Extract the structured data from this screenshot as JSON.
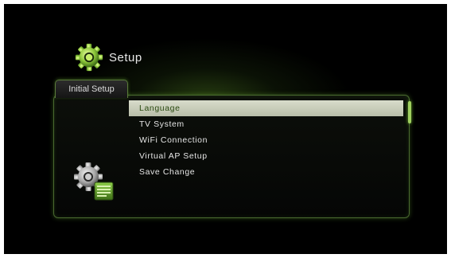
{
  "header": {
    "title": "Setup",
    "icon": "gear-icon"
  },
  "tab": {
    "label": "Initial Setup"
  },
  "menu": {
    "items": [
      {
        "label": "Language",
        "selected": true
      },
      {
        "label": "TV System",
        "selected": false
      },
      {
        "label": "WiFi Connection",
        "selected": false
      },
      {
        "label": "Virtual AP Setup",
        "selected": false
      },
      {
        "label": "Save Change",
        "selected": false
      }
    ]
  },
  "panel_icon": "settings-document-icon",
  "colors": {
    "accent_green": "#7cc02a",
    "selection_bg": "#c8ccb8",
    "selection_text": "#2a4a10",
    "text": "#e6e6e6",
    "background": "#000000"
  }
}
